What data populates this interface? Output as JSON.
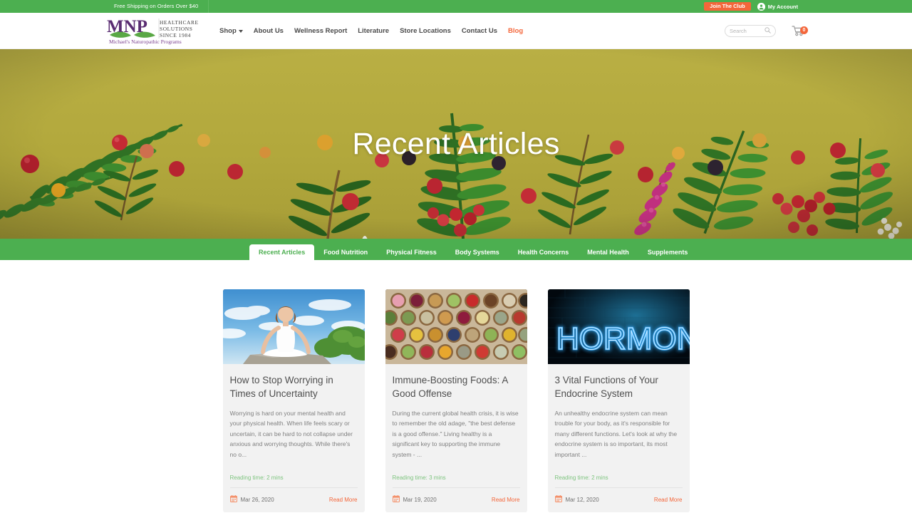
{
  "topbar": {
    "shipping_note": "Free Shipping on Orders Over $40",
    "join_club_label": "Join The Club",
    "account_label": "My Account",
    "account_icon": "user-circle-icon",
    "accent_color": "#f4663a",
    "background_color": "#4caf50"
  },
  "header": {
    "logo": {
      "mark": "MNP",
      "line1": "HEALTHCARE",
      "line2": "SOLUTIONS",
      "line3": "SINCE 1984",
      "tagline": "Michael's Naturopathic Programs"
    },
    "nav": [
      {
        "label": "Shop",
        "has_dropdown": true,
        "highlight": false
      },
      {
        "label": "About Us",
        "has_dropdown": false,
        "highlight": false
      },
      {
        "label": "Wellness Report",
        "has_dropdown": false,
        "highlight": false
      },
      {
        "label": "Literature",
        "has_dropdown": false,
        "highlight": false
      },
      {
        "label": "Store Locations",
        "has_dropdown": false,
        "highlight": false
      },
      {
        "label": "Contact Us",
        "has_dropdown": false,
        "highlight": false
      },
      {
        "label": "Blog",
        "has_dropdown": false,
        "highlight": true
      }
    ],
    "search": {
      "placeholder": "Search",
      "value": "",
      "icon": "search-icon"
    },
    "cart": {
      "icon": "shopping-cart-icon",
      "count": "0"
    }
  },
  "hero": {
    "title": "Recent Articles",
    "background_color": "#b3a93d",
    "description": "Flat-lay of ferns, berries and wildflowers on an olive background"
  },
  "tabs": [
    {
      "label": "Recent Articles",
      "active": true
    },
    {
      "label": "Food Nutrition",
      "active": false
    },
    {
      "label": "Physical Fitness",
      "active": false
    },
    {
      "label": "Body Systems",
      "active": false
    },
    {
      "label": "Health Concerns",
      "active": false
    },
    {
      "label": "Mental Health",
      "active": false
    },
    {
      "label": "Supplements",
      "active": false
    }
  ],
  "articles": [
    {
      "title": "How to Stop Worrying in Times of Uncertainty",
      "excerpt": "Worrying is hard on your mental health and your physical health. When life feels scary or uncertain, it can be hard to not collapse under anxious and worrying thoughts. While there's no o...",
      "reading_time": "Reading time: 2 mins",
      "date": "Mar 26, 2020",
      "read_more": "Read More",
      "image_alt": "woman-meditating-outdoors-photo"
    },
    {
      "title": "Immune-Boosting Foods: A Good Offense",
      "excerpt": "During the current global health crisis, it is wise to remember the old adage, \"the best defense is a good offense.\" Living healthy is a significant key to supporting the immune system - ...",
      "reading_time": "Reading time: 3 mins",
      "date": "Mar 19, 2020",
      "read_more": "Read More",
      "image_alt": "grid-of-bowls-with-fruits-and-spices-photo"
    },
    {
      "title": "3 Vital Functions of Your Endocrine System",
      "excerpt": "An unhealthy endocrine system can mean trouble for your body, as it's responsible for many different functions. Let's look at why the endocrine system is so important, its most important ...",
      "reading_time": "Reading time: 2 mins",
      "date": "Mar 12, 2020",
      "read_more": "Read More",
      "image_alt": "hormones-blue-neon-sign-photo"
    }
  ],
  "colors": {
    "brand_green": "#4caf50",
    "accent_orange": "#f4663a",
    "reading_time_green": "#7ec47f",
    "card_background": "#f2f2f2"
  }
}
